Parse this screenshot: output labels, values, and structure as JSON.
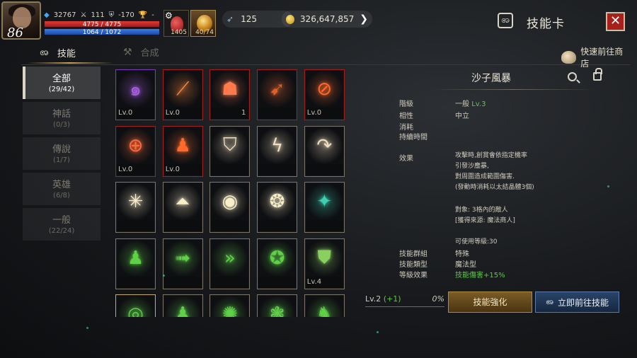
{
  "player": {
    "level": "86",
    "wing_value": "32767",
    "attack": "111",
    "defense": "-170",
    "trophy": "-",
    "hp": "4775 / 4775",
    "mp": "1064 / 1072"
  },
  "buffs": [
    {
      "label": "1405"
    },
    {
      "label": "40/74"
    }
  ],
  "currencies": {
    "feather": "125",
    "gold": "326,647,857"
  },
  "header": {
    "title": "技能卡"
  },
  "tabs": [
    {
      "label": "技能",
      "active": true
    },
    {
      "label": "合成",
      "active": false
    }
  ],
  "shop_link": "快速前往商店",
  "categories": [
    {
      "name": "全部",
      "count": "(29/42)",
      "active": true
    },
    {
      "name": "神話",
      "count": "(0/3)"
    },
    {
      "name": "傳說",
      "count": "(1/7)"
    },
    {
      "name": "英雄",
      "count": "(6/8)"
    },
    {
      "name": "一般",
      "count": "(22/24)"
    }
  ],
  "cards": [
    {
      "rarity": "purple",
      "level": "Lv.0",
      "count": "",
      "icon": "purple-swirl-icon",
      "color": "#a65ee0"
    },
    {
      "rarity": "red",
      "level": "Lv.0",
      "count": "",
      "icon": "slash-icon",
      "color": "#ff8a3a"
    },
    {
      "rarity": "red",
      "level": "",
      "count": "1",
      "icon": "warrior-figure-icon",
      "color": "#ff7a4a"
    },
    {
      "rarity": "red",
      "level": "",
      "count": "",
      "icon": "spear-icon",
      "color": "#e0602a"
    },
    {
      "rarity": "red",
      "level": "Lv.0",
      "count": "",
      "icon": "sword-circle-icon",
      "color": "#ff6a2a"
    },
    {
      "rarity": "red",
      "level": "Lv.0",
      "count": "",
      "icon": "cross-rune-icon",
      "color": "#ff6a3a"
    },
    {
      "rarity": "red",
      "level": "Lv.0",
      "count": "",
      "icon": "aura-figure-icon",
      "color": "#ff6a2a"
    },
    {
      "rarity": "gray",
      "level": "",
      "count": "",
      "icon": "shield-icon",
      "color": "#f0e0c0"
    },
    {
      "rarity": "gray",
      "level": "",
      "count": "",
      "icon": "lightning-icon",
      "color": "#f0e0c0"
    },
    {
      "rarity": "gray",
      "level": "",
      "count": "",
      "icon": "curved-arrow-icon",
      "color": "#f0e0c0"
    },
    {
      "rarity": "gray",
      "level": "",
      "count": "",
      "icon": "burst-icon",
      "color": "#f8eec8"
    },
    {
      "rarity": "gray",
      "level": "",
      "count": "",
      "icon": "pyramid-icon",
      "color": "#f8eec8"
    },
    {
      "rarity": "gray",
      "level": "",
      "count": "",
      "icon": "eye-icon",
      "color": "#f8eec8"
    },
    {
      "rarity": "gray",
      "level": "",
      "count": "",
      "icon": "spiral-icon",
      "color": "#f8eec8"
    },
    {
      "rarity": "gray",
      "level": "",
      "count": "",
      "icon": "teal-sword-icon",
      "color": "#3ad0b0"
    },
    {
      "rarity": "gray",
      "level": "",
      "count": "",
      "icon": "green-figure-icon",
      "color": "#5fd048"
    },
    {
      "rarity": "gray",
      "level": "",
      "count": "",
      "icon": "green-dash-icon",
      "color": "#5fd048"
    },
    {
      "rarity": "gray",
      "level": "",
      "count": "",
      "icon": "double-chevron-icon",
      "color": "#5fd048"
    },
    {
      "rarity": "gray",
      "level": "",
      "count": "",
      "icon": "green-swirl-icon",
      "color": "#5fd048"
    },
    {
      "rarity": "gray",
      "level": "Lv.4",
      "count": "",
      "icon": "green-shield-icon",
      "color": "#8ad060"
    },
    {
      "rarity": "gold",
      "level": "",
      "count": "",
      "icon": "green-ring-icon",
      "color": "#5fd048"
    },
    {
      "rarity": "gray",
      "level": "",
      "count": "",
      "icon": "green-figure2-icon",
      "color": "#5fd048"
    },
    {
      "rarity": "gray",
      "level": "",
      "count": "",
      "icon": "green-splash-icon",
      "color": "#5fd048"
    },
    {
      "rarity": "gray",
      "level": "",
      "count": "",
      "icon": "green-emblem-icon",
      "color": "#5fd048"
    },
    {
      "rarity": "gray",
      "level": "",
      "count": "",
      "icon": "green-creature-icon",
      "color": "#5fd048"
    }
  ],
  "detail": {
    "name": "沙子風暴",
    "rank_label": "階級",
    "rank_value": "一般",
    "rank_level": "Lv.3",
    "attr_label": "相性",
    "attr_value": "中立",
    "cost_label": "消耗",
    "duration_label": "持續時間",
    "effect_label": "效果",
    "effect_lines": [
      "攻擊時,創賞會依指定機率",
      "引發沙塵暴,",
      "對周圍造成範圍傷害.",
      "(發動時消耗以太結晶體3個)"
    ],
    "target_line": "對象: 3格內的敵人",
    "source_line": "[獲得來源: 魔法商人]",
    "usable_level": "可使用等級:30",
    "group_label": "技能群組",
    "group_value": "特殊",
    "type_label": "技能類型",
    "type_value": "魔法型",
    "level_effect_label": "等級效果",
    "level_effect_value": "技能傷害+15%"
  },
  "progress": {
    "level_text": "Lv.2",
    "bonus": "(+1)",
    "percent": "0%"
  },
  "buttons": {
    "enhance": "技能強化",
    "go_to_skill": "立即前往技能"
  }
}
